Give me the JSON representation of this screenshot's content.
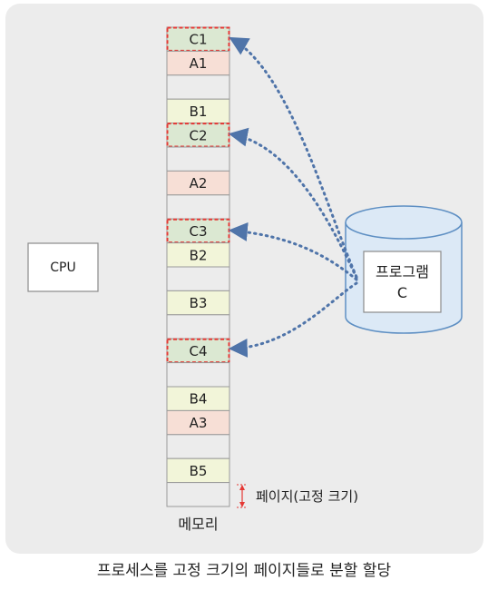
{
  "cpu": {
    "label": "CPU"
  },
  "memory": {
    "label": "메모리",
    "slots": [
      {
        "label": "C1",
        "kind": "C"
      },
      {
        "label": "A1",
        "kind": "A"
      },
      {
        "label": "",
        "kind": "empty"
      },
      {
        "label": "B1",
        "kind": "B"
      },
      {
        "label": "C2",
        "kind": "C"
      },
      {
        "label": "",
        "kind": "empty"
      },
      {
        "label": "A2",
        "kind": "A"
      },
      {
        "label": "",
        "kind": "empty"
      },
      {
        "label": "C3",
        "kind": "C"
      },
      {
        "label": "B2",
        "kind": "B"
      },
      {
        "label": "",
        "kind": "empty"
      },
      {
        "label": "B3",
        "kind": "B"
      },
      {
        "label": "",
        "kind": "empty"
      },
      {
        "label": "C4",
        "kind": "C"
      },
      {
        "label": "",
        "kind": "empty"
      },
      {
        "label": "B4",
        "kind": "B"
      },
      {
        "label": "A3",
        "kind": "A"
      },
      {
        "label": "",
        "kind": "empty"
      },
      {
        "label": "B5",
        "kind": "B"
      },
      {
        "label": "",
        "kind": "empty"
      }
    ]
  },
  "page_note": "페이지(고정 크기)",
  "program": {
    "line1": "프로그램",
    "line2": "C"
  },
  "caption": "프로세스를 고정 크기의 페이지들로 분할 할당",
  "colors": {
    "panel_bg": "#ececec",
    "slot_c": "#dbe8d2",
    "slot_a": "#f7dfd6",
    "slot_b": "#f2f5d9",
    "slot_empty": "#ececec",
    "highlight_border": "#e53935",
    "arrow": "#4f74a9",
    "cylinder": "#dce9f6",
    "page_marker": "#e53935"
  }
}
